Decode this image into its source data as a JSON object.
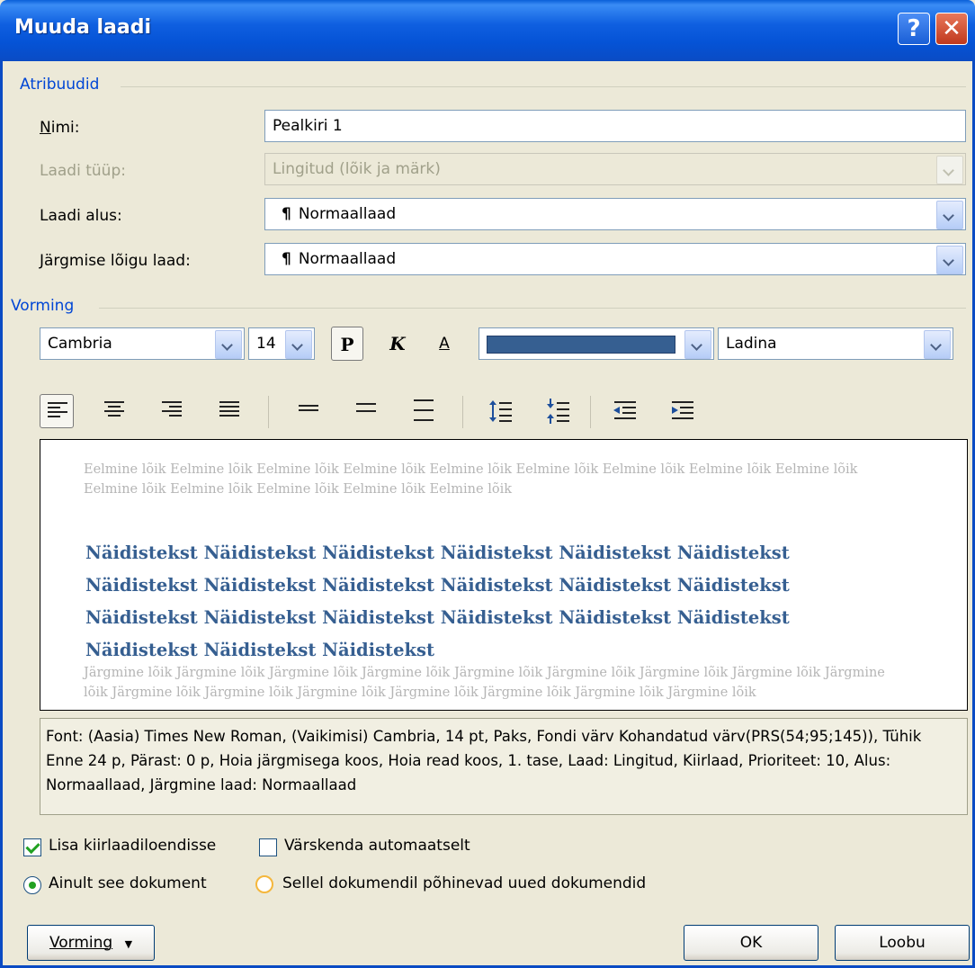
{
  "window": {
    "title": "Muuda laadi"
  },
  "attributes": {
    "group_label": "Atribuudid",
    "name_label": "Nimi:",
    "name_value": "Pealkiri 1",
    "type_label": "Laadi tüüp:",
    "type_value": "Lingitud (lõik ja märk)",
    "based_on_label": "Laadi alus:",
    "based_on_value": "Normaallaad",
    "next_label": "Järgmise lõigu laad:",
    "next_value": "Normaallaad",
    "pilcrow": "¶"
  },
  "formatting": {
    "group_label": "Vorming",
    "font": "Cambria",
    "size": "14",
    "bold_label": "P",
    "italic_label": "K",
    "underline_label": "A",
    "color": "#365f91",
    "language": "Ladina"
  },
  "preview": {
    "previous_paragraph": "Eelmine lõik Eelmine lõik Eelmine lõik Eelmine lõik Eelmine lõik Eelmine lõik Eelmine lõik Eelmine lõik Eelmine lõik Eelmine lõik Eelmine lõik Eelmine lõik Eelmine lõik Eelmine lõik",
    "sample_text": "Näidistekst Näidistekst Näidistekst Näidistekst Näidistekst Näidistekst Näidistekst Näidistekst Näidistekst Näidistekst Näidistekst Näidistekst Näidistekst Näidistekst Näidistekst Näidistekst Näidistekst Näidistekst Näidistekst Näidistekst Näidistekst",
    "next_paragraph": "Järgmine lõik Järgmine lõik Järgmine lõik Järgmine lõik Järgmine lõik Järgmine lõik Järgmine lõik Järgmine lõik Järgmine lõik Järgmine lõik Järgmine lõik Järgmine lõik Järgmine lõik Järgmine lõik Järgmine lõik Järgmine lõik"
  },
  "description": "Font: (Aasia) Times New Roman, (Vaikimisi) Cambria, 14 pt, Paks, Fondi värv Kohandatud värv(PRS(54;95;145)), Tühik Enne  24 p, Pärast:  0 p, Hoia järgmisega koos, Hoia read koos, 1. tase, Laad: Lingitud, Kiirlaad, Prioriteet: 10, Alus: Normaallaad, Järgmine laad: Normaallaad",
  "options": {
    "add_to_quick": "Lisa kiirlaadiloendisse",
    "add_to_quick_checked": true,
    "auto_update": "Värskenda automaatselt",
    "auto_update_checked": false,
    "only_this_doc": "Ainult see dokument",
    "new_docs": "Sellel dokumendil põhinevad uued dokumendid"
  },
  "buttons": {
    "format": "Vorming",
    "format_arrow": "▼",
    "ok": "OK",
    "cancel": "Loobu",
    "help": "?",
    "close": "✕"
  }
}
